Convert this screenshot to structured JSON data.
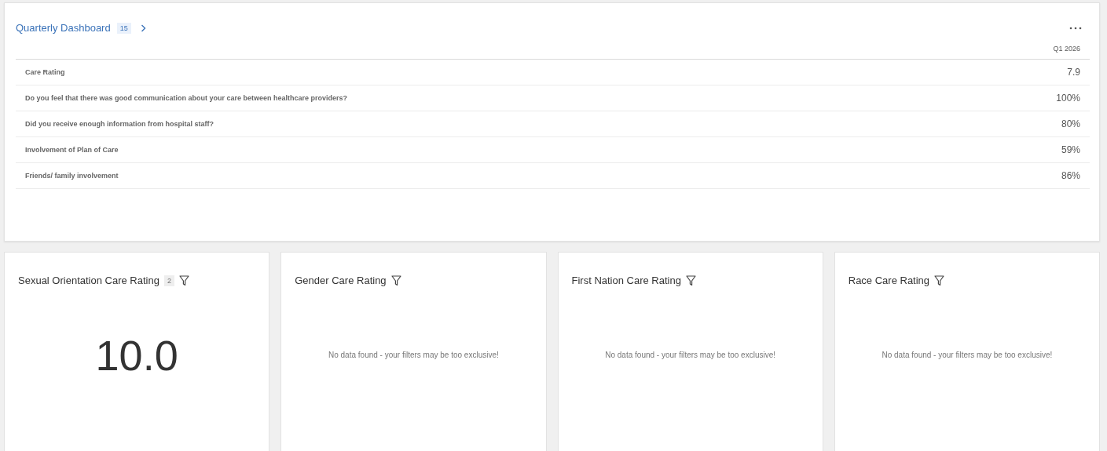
{
  "dashboard": {
    "title": "Quarterly Dashboard",
    "count": "15",
    "column": "Q1 2026",
    "rows": [
      {
        "label": "Care Rating",
        "value": "7.9"
      },
      {
        "label": "Do you feel that there was good communication about your care between healthcare providers?",
        "value": "100%"
      },
      {
        "label": "Did you receive enough information from hospital staff?",
        "value": "80%"
      },
      {
        "label": "Involvement of Plan of Care",
        "value": "59%"
      },
      {
        "label": "Friends/ family involvement",
        "value": "86%"
      }
    ]
  },
  "tiles": [
    {
      "kind": "value",
      "title": "Sexual Orientation Care Rating",
      "count": "2",
      "value": "10.0"
    },
    {
      "kind": "empty",
      "title": "Gender Care Rating",
      "message": "No data found - your filters may be too exclusive!"
    },
    {
      "kind": "empty",
      "title": "First Nation Care Rating",
      "message": "No data found - your filters may be too exclusive!"
    },
    {
      "kind": "empty",
      "title": "Race Care Rating",
      "message": "No data found - your filters may be too exclusive!"
    }
  ]
}
